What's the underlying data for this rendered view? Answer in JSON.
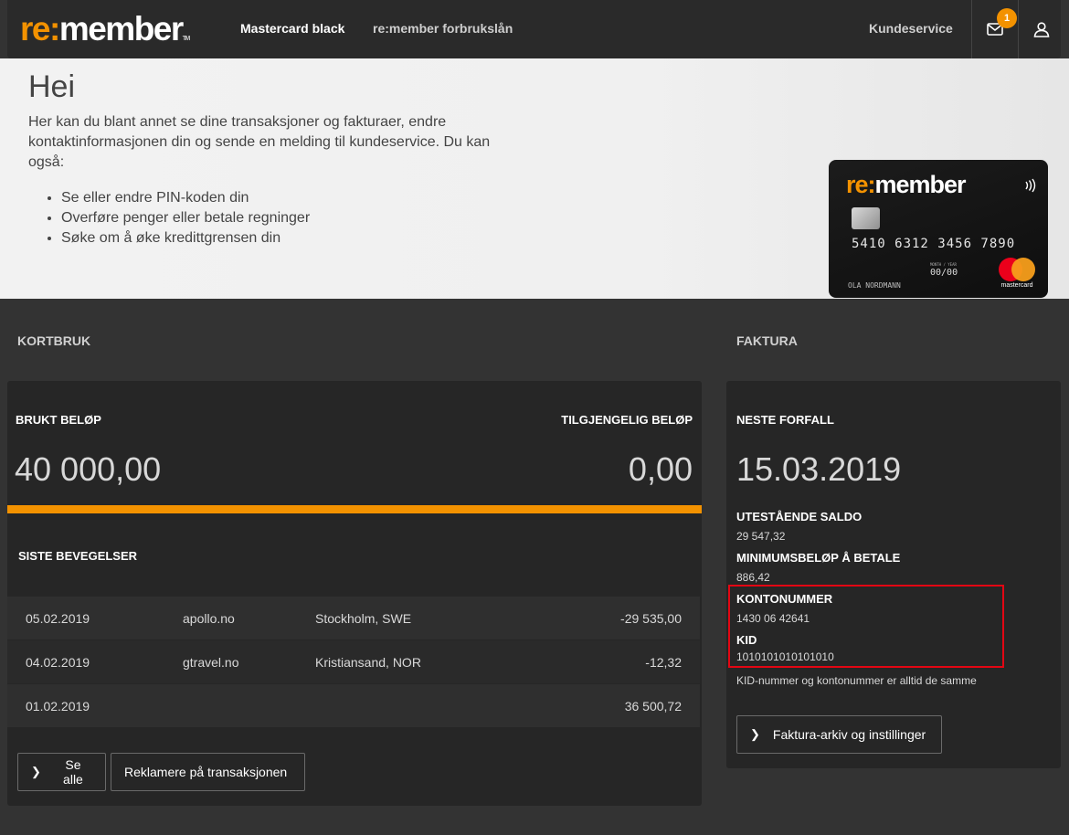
{
  "header": {
    "logo": {
      "re": "re:",
      "member": "member",
      "tm": "TM"
    },
    "nav": [
      "Mastercard black",
      "re:member forbrukslån"
    ],
    "kundeservice": "Kundeservice",
    "mail_badge": "1",
    "colors": {
      "accent": "#f39200",
      "header_bg": "#2a2a2a"
    }
  },
  "hero": {
    "greeting": "Hei",
    "intro": "Her kan du blant annet se dine transaksjoner og fakturaer, endre kontaktinformasjonen din og sende en melding til kundeservice. Du kan også:",
    "bullets": [
      "Se eller endre PIN-koden din",
      "Overføre penger eller betale regninger",
      "Søke om å øke kredittgrensen din"
    ]
  },
  "card": {
    "logo_re": "re:",
    "logo_member": "member",
    "number": "5410 6312 3456 7890",
    "valid_label": "MONTH / YEAR",
    "expiry": "00/00",
    "holder": "OLA NORDMANN",
    "brand": "mastercard"
  },
  "kortbruk": {
    "section_title": "KORTBRUK",
    "used_label": "BRUKT BELØP",
    "used_value": "40 000,00",
    "available_label": "TILGJENGELIG BELØP",
    "available_value": "0,00",
    "usage_fraction": 1.0,
    "movements_title": "SISTE BEVEGELSER",
    "transactions": [
      {
        "date": "05.02.2019",
        "merchant": "apollo.no",
        "place": "Stockholm, SWE",
        "amount": "-29 535,00"
      },
      {
        "date": "04.02.2019",
        "merchant": "gtravel.no",
        "place": "Kristiansand, NOR",
        "amount": "-12,32"
      },
      {
        "date": "01.02.2019",
        "merchant": "",
        "place": "",
        "amount": "36 500,72"
      }
    ],
    "see_all": "Se alle",
    "complain": "Reklamere på transaksjonen"
  },
  "faktura": {
    "section_title": "FAKTURA",
    "next_due_label": "NESTE FORFALL",
    "next_due": "15.03.2019",
    "balance_label": "UTESTÅENDE SALDO",
    "balance": "29 547,32",
    "min_label": "MINIMUMSBELØP Å BETALE",
    "min": "886,42",
    "account_label": "KONTONUMMER",
    "account": "1430 06 42641",
    "kid_label": "KID",
    "kid": "1010101010101010",
    "note": "KID-nummer og kontonummer er alltid de samme",
    "archive_button": "Faktura-arkiv og instillinger"
  }
}
